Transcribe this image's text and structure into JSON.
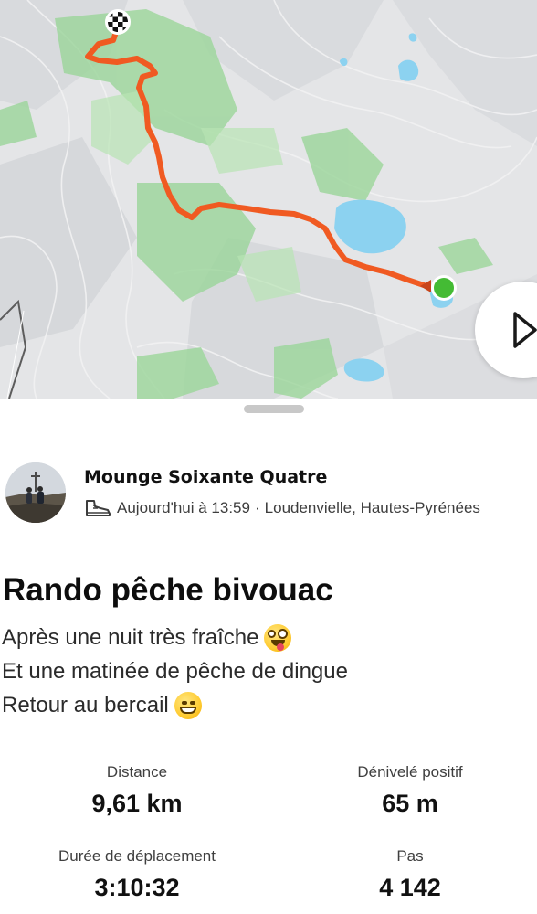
{
  "map": {
    "route_color": "#f05a22",
    "start_marker_color": "#44bb34",
    "finish_marker": "checkered-flag-icon",
    "next_button_icon": "chevron-right-icon"
  },
  "activity": {
    "athlete_name": "Mounge Soixante Quatre",
    "activity_type_icon": "hiking-shoe-icon",
    "datetime": "Aujourd'hui à 13:59",
    "separator": "·",
    "location": "Loudenvielle, Hautes-Pyrénées",
    "title": "Rando pêche bivouac",
    "description": [
      {
        "text": "Après une nuit très fraîche",
        "emoji": "zany-face-emoji"
      },
      {
        "text": "Et une matinée de pêche de dingue",
        "emoji": ""
      },
      {
        "text": "Retour au bercail",
        "emoji": "grinning-face-emoji"
      }
    ]
  },
  "stats": {
    "distance_label": "Distance",
    "distance_value": "9,61 km",
    "elevation_label": "Dénivelé positif",
    "elevation_value": "65 m",
    "moving_time_label": "Durée de déplacement",
    "moving_time_value": "3:10:32",
    "steps_label": "Pas",
    "steps_value": "4 142"
  }
}
